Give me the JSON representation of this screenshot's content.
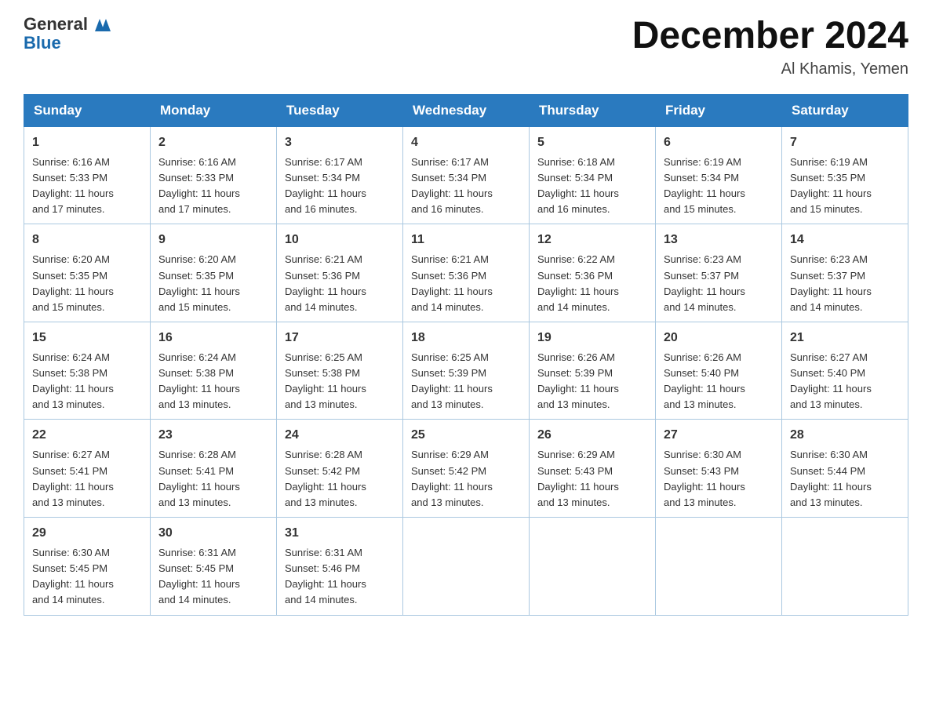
{
  "header": {
    "logo_general": "General",
    "logo_blue": "Blue",
    "title": "December 2024",
    "subtitle": "Al Khamis, Yemen"
  },
  "weekdays": [
    "Sunday",
    "Monday",
    "Tuesday",
    "Wednesday",
    "Thursday",
    "Friday",
    "Saturday"
  ],
  "weeks": [
    [
      {
        "day": "1",
        "sunrise": "6:16 AM",
        "sunset": "5:33 PM",
        "daylight": "11 hours and 17 minutes."
      },
      {
        "day": "2",
        "sunrise": "6:16 AM",
        "sunset": "5:33 PM",
        "daylight": "11 hours and 17 minutes."
      },
      {
        "day": "3",
        "sunrise": "6:17 AM",
        "sunset": "5:34 PM",
        "daylight": "11 hours and 16 minutes."
      },
      {
        "day": "4",
        "sunrise": "6:17 AM",
        "sunset": "5:34 PM",
        "daylight": "11 hours and 16 minutes."
      },
      {
        "day": "5",
        "sunrise": "6:18 AM",
        "sunset": "5:34 PM",
        "daylight": "11 hours and 16 minutes."
      },
      {
        "day": "6",
        "sunrise": "6:19 AM",
        "sunset": "5:34 PM",
        "daylight": "11 hours and 15 minutes."
      },
      {
        "day": "7",
        "sunrise": "6:19 AM",
        "sunset": "5:35 PM",
        "daylight": "11 hours and 15 minutes."
      }
    ],
    [
      {
        "day": "8",
        "sunrise": "6:20 AM",
        "sunset": "5:35 PM",
        "daylight": "11 hours and 15 minutes."
      },
      {
        "day": "9",
        "sunrise": "6:20 AM",
        "sunset": "5:35 PM",
        "daylight": "11 hours and 15 minutes."
      },
      {
        "day": "10",
        "sunrise": "6:21 AM",
        "sunset": "5:36 PM",
        "daylight": "11 hours and 14 minutes."
      },
      {
        "day": "11",
        "sunrise": "6:21 AM",
        "sunset": "5:36 PM",
        "daylight": "11 hours and 14 minutes."
      },
      {
        "day": "12",
        "sunrise": "6:22 AM",
        "sunset": "5:36 PM",
        "daylight": "11 hours and 14 minutes."
      },
      {
        "day": "13",
        "sunrise": "6:23 AM",
        "sunset": "5:37 PM",
        "daylight": "11 hours and 14 minutes."
      },
      {
        "day": "14",
        "sunrise": "6:23 AM",
        "sunset": "5:37 PM",
        "daylight": "11 hours and 14 minutes."
      }
    ],
    [
      {
        "day": "15",
        "sunrise": "6:24 AM",
        "sunset": "5:38 PM",
        "daylight": "11 hours and 13 minutes."
      },
      {
        "day": "16",
        "sunrise": "6:24 AM",
        "sunset": "5:38 PM",
        "daylight": "11 hours and 13 minutes."
      },
      {
        "day": "17",
        "sunrise": "6:25 AM",
        "sunset": "5:38 PM",
        "daylight": "11 hours and 13 minutes."
      },
      {
        "day": "18",
        "sunrise": "6:25 AM",
        "sunset": "5:39 PM",
        "daylight": "11 hours and 13 minutes."
      },
      {
        "day": "19",
        "sunrise": "6:26 AM",
        "sunset": "5:39 PM",
        "daylight": "11 hours and 13 minutes."
      },
      {
        "day": "20",
        "sunrise": "6:26 AM",
        "sunset": "5:40 PM",
        "daylight": "11 hours and 13 minutes."
      },
      {
        "day": "21",
        "sunrise": "6:27 AM",
        "sunset": "5:40 PM",
        "daylight": "11 hours and 13 minutes."
      }
    ],
    [
      {
        "day": "22",
        "sunrise": "6:27 AM",
        "sunset": "5:41 PM",
        "daylight": "11 hours and 13 minutes."
      },
      {
        "day": "23",
        "sunrise": "6:28 AM",
        "sunset": "5:41 PM",
        "daylight": "11 hours and 13 minutes."
      },
      {
        "day": "24",
        "sunrise": "6:28 AM",
        "sunset": "5:42 PM",
        "daylight": "11 hours and 13 minutes."
      },
      {
        "day": "25",
        "sunrise": "6:29 AM",
        "sunset": "5:42 PM",
        "daylight": "11 hours and 13 minutes."
      },
      {
        "day": "26",
        "sunrise": "6:29 AM",
        "sunset": "5:43 PM",
        "daylight": "11 hours and 13 minutes."
      },
      {
        "day": "27",
        "sunrise": "6:30 AM",
        "sunset": "5:43 PM",
        "daylight": "11 hours and 13 minutes."
      },
      {
        "day": "28",
        "sunrise": "6:30 AM",
        "sunset": "5:44 PM",
        "daylight": "11 hours and 13 minutes."
      }
    ],
    [
      {
        "day": "29",
        "sunrise": "6:30 AM",
        "sunset": "5:45 PM",
        "daylight": "11 hours and 14 minutes."
      },
      {
        "day": "30",
        "sunrise": "6:31 AM",
        "sunset": "5:45 PM",
        "daylight": "11 hours and 14 minutes."
      },
      {
        "day": "31",
        "sunrise": "6:31 AM",
        "sunset": "5:46 PM",
        "daylight": "11 hours and 14 minutes."
      },
      null,
      null,
      null,
      null
    ]
  ]
}
